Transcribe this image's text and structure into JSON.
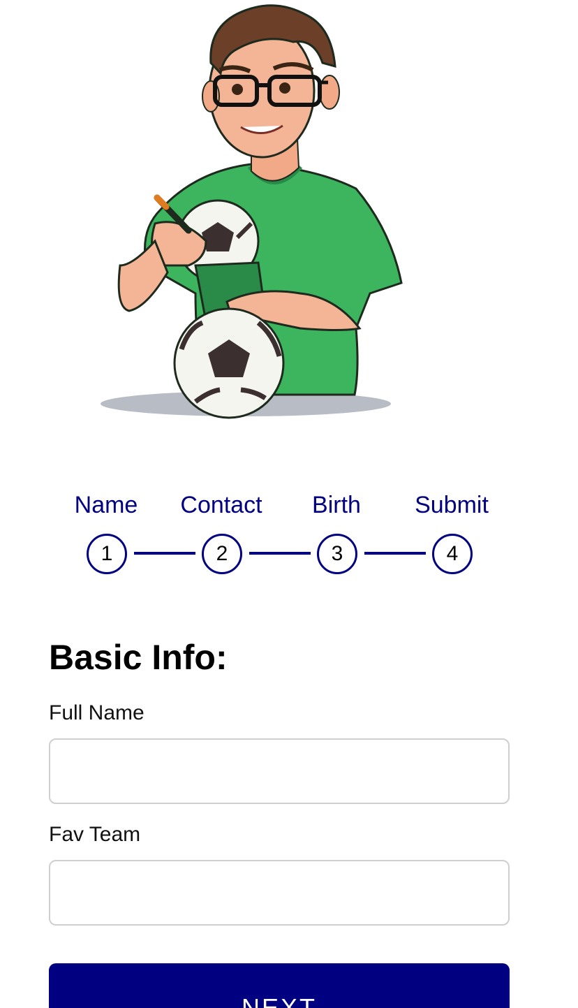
{
  "hero": {
    "illustration": "cartoon-man-with-soccer-balls-and-notepad"
  },
  "steps": [
    {
      "label": "Name",
      "number": "1"
    },
    {
      "label": "Contact",
      "number": "2"
    },
    {
      "label": "Birth",
      "number": "3"
    },
    {
      "label": "Submit",
      "number": "4"
    }
  ],
  "form": {
    "title": "Basic Info:",
    "fields": [
      {
        "label": "Full Name",
        "value": "",
        "placeholder": ""
      },
      {
        "label": "Fav Team",
        "value": "",
        "placeholder": ""
      }
    ],
    "next_label": "NEXT"
  },
  "colors": {
    "accent": "#000080",
    "input_border": "#cfcfcf",
    "shirt": "#3cb55e"
  }
}
